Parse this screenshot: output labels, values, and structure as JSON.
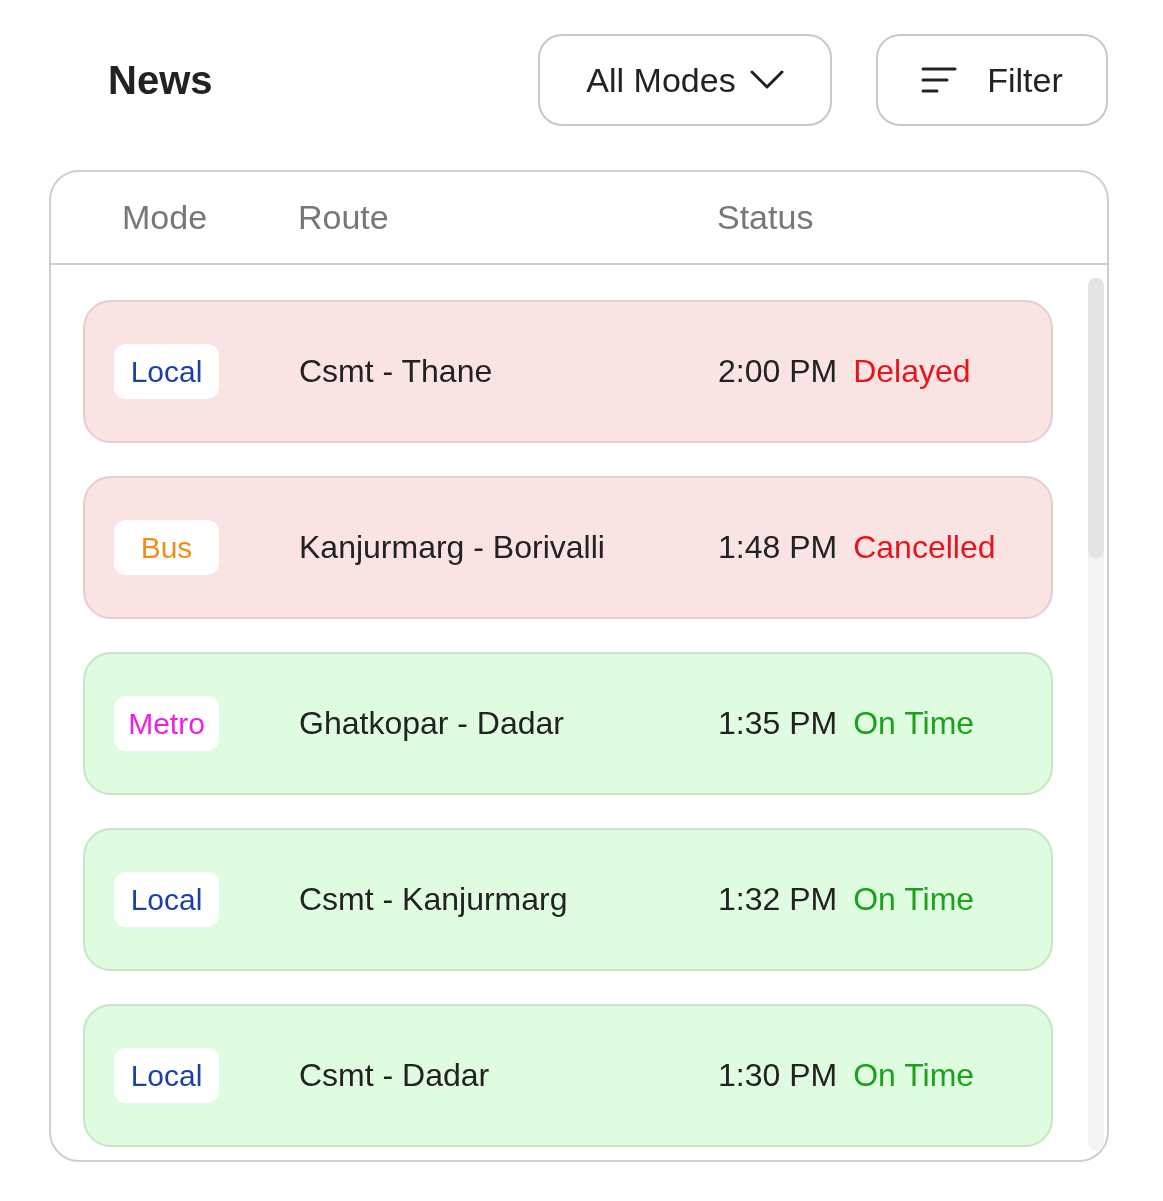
{
  "header": {
    "title": "News",
    "mode_dropdown": {
      "label": "All Modes"
    },
    "filter_button": {
      "label": "Filter"
    }
  },
  "table": {
    "columns": [
      "Mode",
      "Route",
      "Status"
    ],
    "rows": [
      {
        "mode": "Local",
        "color": "#1d3fa8",
        "route": "Csmt - Thane",
        "time": "2:00 PM",
        "status": "Delayed",
        "kind": "alert"
      },
      {
        "mode": "Bus",
        "color": "#f0901a",
        "route": "Kanjurmarg - Borivalli",
        "time": "1:48 PM",
        "status": "Cancelled",
        "kind": "alert"
      },
      {
        "mode": "Metro",
        "color": "#f020e0",
        "route": "Ghatkopar - Dadar",
        "time": "1:35 PM",
        "status": "On Time",
        "kind": "ok"
      },
      {
        "mode": "Local",
        "color": "#1d3fa8",
        "route": "Csmt - Kanjurmarg",
        "time": "1:32 PM",
        "status": "On Time",
        "kind": "ok"
      },
      {
        "mode": "Local",
        "color": "#1d3fa8",
        "route": "Csmt - Dadar",
        "time": "1:30 PM",
        "status": "On Time",
        "kind": "ok"
      }
    ]
  }
}
